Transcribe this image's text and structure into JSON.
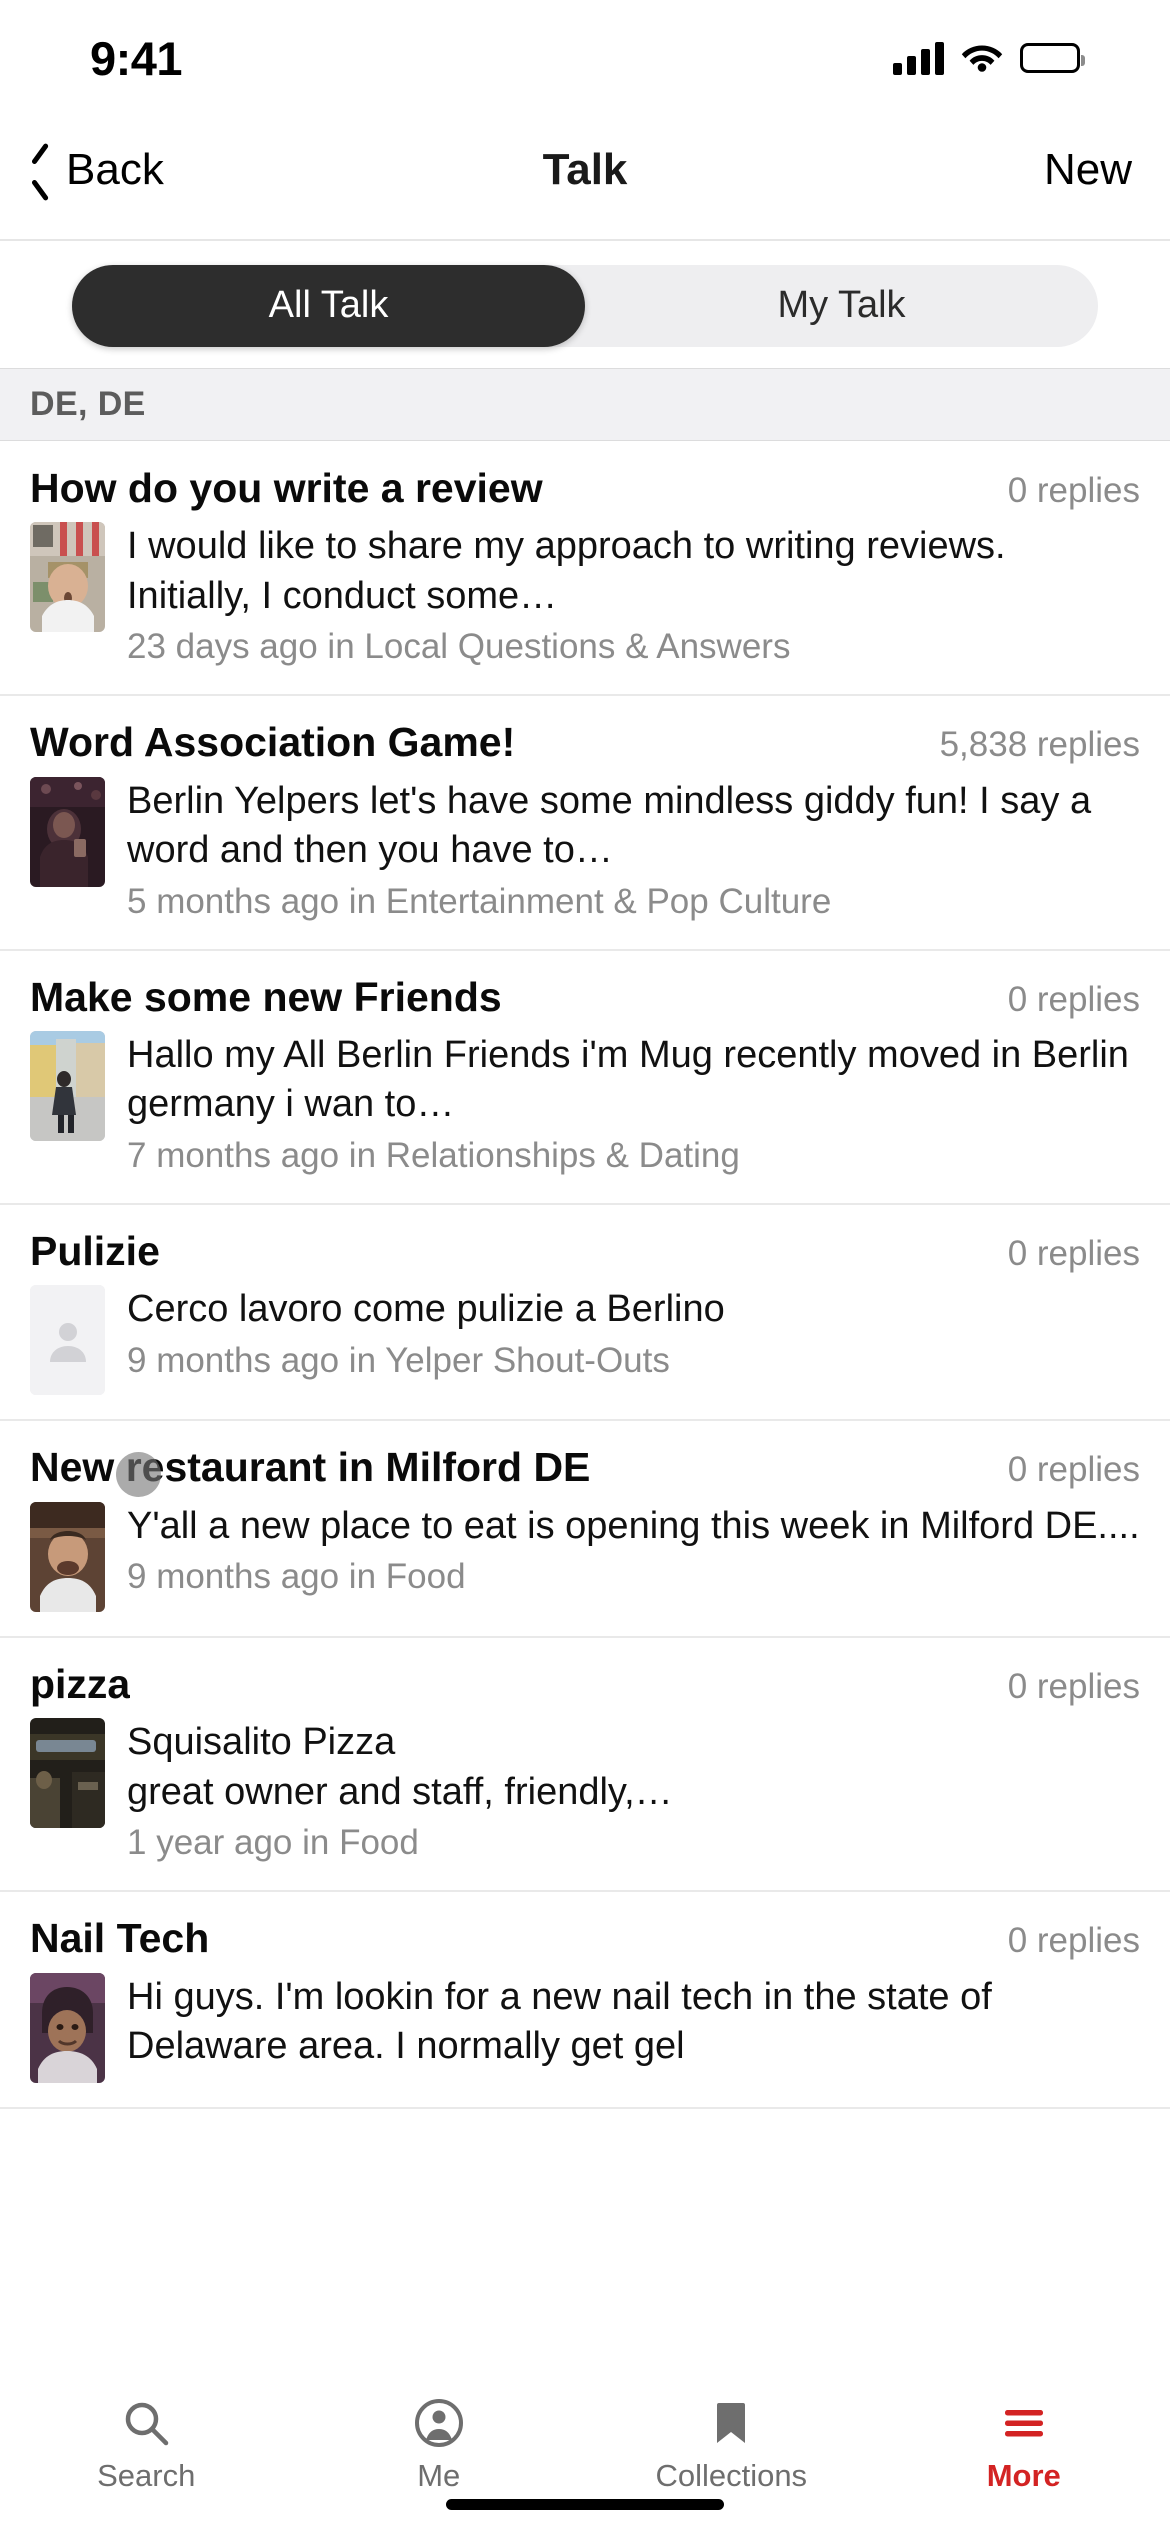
{
  "status_bar": {
    "time": "9:41",
    "cellular_icon": "signal-bars-icon",
    "wifi_icon": "wifi-icon",
    "battery_icon": "battery-full-icon"
  },
  "nav": {
    "back_label": "Back",
    "back_icon": "chevron-left-icon",
    "title": "Talk",
    "new_label": "New"
  },
  "segmented_control": {
    "selected": "All Talk",
    "options": [
      {
        "label": "All Talk",
        "active": true
      },
      {
        "label": "My Talk",
        "active": false
      }
    ]
  },
  "location_header": {
    "label": "DE, DE"
  },
  "threads": [
    {
      "title": "How do you write a review",
      "replies": "0 replies",
      "snippet": "I would like to share my approach to writing reviews. Initially, I conduct some…",
      "meta": "23 days ago in Local Questions & Answers",
      "thumb": "photo-thumbnail",
      "thumb_colors": [
        "#8d7f6d",
        "#c9bda6",
        "#55463a"
      ]
    },
    {
      "title": "Word Association Game!",
      "replies": "5,838 replies",
      "snippet": "Berlin Yelpers let's have some mindless giddy fun! I say a word and then you have to…",
      "meta": "5 months ago in Entertainment & Pop Culture",
      "thumb": "photo-thumbnail",
      "thumb_colors": [
        "#3b2430",
        "#6d4a52",
        "#1d1117"
      ]
    },
    {
      "title": "Make some new Friends",
      "replies": "0 replies",
      "snippet": "Hallo my All Berlin Friends i'm Mug recently moved in Berlin germany i wan to…",
      "meta": "7 months ago in Relationships & Dating",
      "thumb": "photo-thumbnail",
      "thumb_colors": [
        "#9fc4dd",
        "#d8c48a",
        "#3c3c46"
      ]
    },
    {
      "title": "Pulizie",
      "replies": "0 replies",
      "snippet": "Cerco lavoro come pulizie a Berlino",
      "meta": "9 months ago in Yelper Shout-Outs",
      "thumb": "user-placeholder-avatar",
      "thumb_colors": [
        "#f2f2f4"
      ]
    },
    {
      "title": "New restaurant in Milford DE",
      "replies": "0 replies",
      "snippet": "Y'all a new place to eat is opening this week in Milford DE....",
      "meta": "9 months ago in Food",
      "thumb": "photo-thumbnail",
      "thumb_colors": [
        "#6b4a38",
        "#c99a7c",
        "#2a1a12"
      ]
    },
    {
      "title": "pizza",
      "replies": "0 replies",
      "snippet": "Squisalito Pizza\ngreat owner and staff, friendly,…",
      "meta": "1 year ago in Food",
      "thumb": "photo-thumbnail",
      "thumb_colors": [
        "#2d2a22",
        "#6f6a4e",
        "#141210"
      ]
    },
    {
      "title": "Nail Tech",
      "replies": "0 replies",
      "snippet": "Hi guys. I'm lookin for a new nail tech in the state of Delaware area. I normally get gel",
      "meta": "",
      "thumb": "photo-thumbnail",
      "thumb_colors": [
        "#5b3f56",
        "#b0836c",
        "#2a1c26"
      ]
    }
  ],
  "touch_indicator": {
    "name": "touch-point",
    "color": "#787878"
  },
  "tab_bar": {
    "items": [
      {
        "label": "Search",
        "icon": "search-icon",
        "active": false
      },
      {
        "label": "Me",
        "icon": "person-circle-icon",
        "active": false
      },
      {
        "label": "Collections",
        "icon": "bookmark-icon",
        "active": false
      },
      {
        "label": "More",
        "icon": "hamburger-menu-icon",
        "active": true
      }
    ],
    "active_color": "#d32323",
    "inactive_color": "#6e6e6e"
  }
}
